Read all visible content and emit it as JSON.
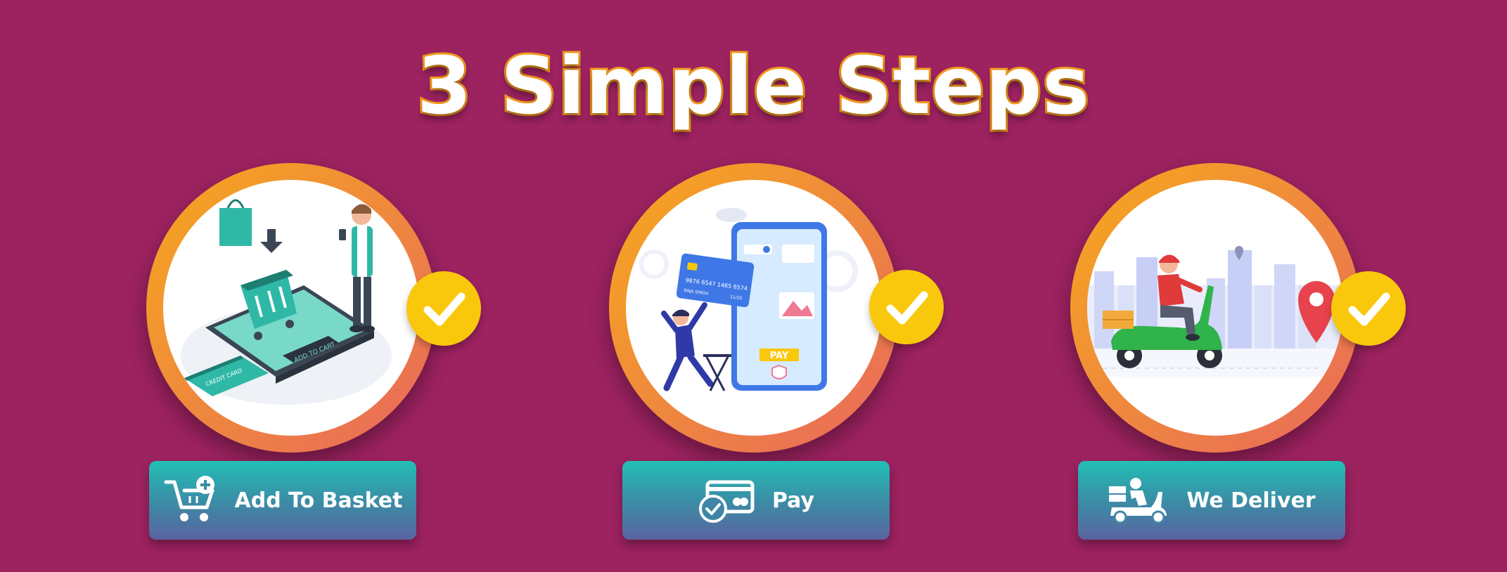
{
  "title": "3 Simple Steps",
  "colors": {
    "background": "#9c2260",
    "ring": "#f29a1a",
    "check_badge": "#f9c80c",
    "button_top": "#22bfb5",
    "button_bottom": "#5a63a0"
  },
  "steps": [
    {
      "label": "Add To Basket",
      "icon": "cart-plus-icon",
      "illustration": "shopping-basket-illustration",
      "illustration_texts": {
        "card": "CREDIT CARD",
        "button": "ADD TO CART"
      }
    },
    {
      "label": "Pay",
      "icon": "credit-card-check-icon",
      "illustration": "mobile-payment-illustration",
      "illustration_texts": {
        "card_number": "9876  6547  1465  6574",
        "card_name": "RAJA SINGH",
        "card_exp": "11/20",
        "pay_button": "PAY"
      }
    },
    {
      "label": "We Deliver",
      "icon": "delivery-scooter-icon",
      "illustration": "scooter-delivery-illustration"
    }
  ]
}
